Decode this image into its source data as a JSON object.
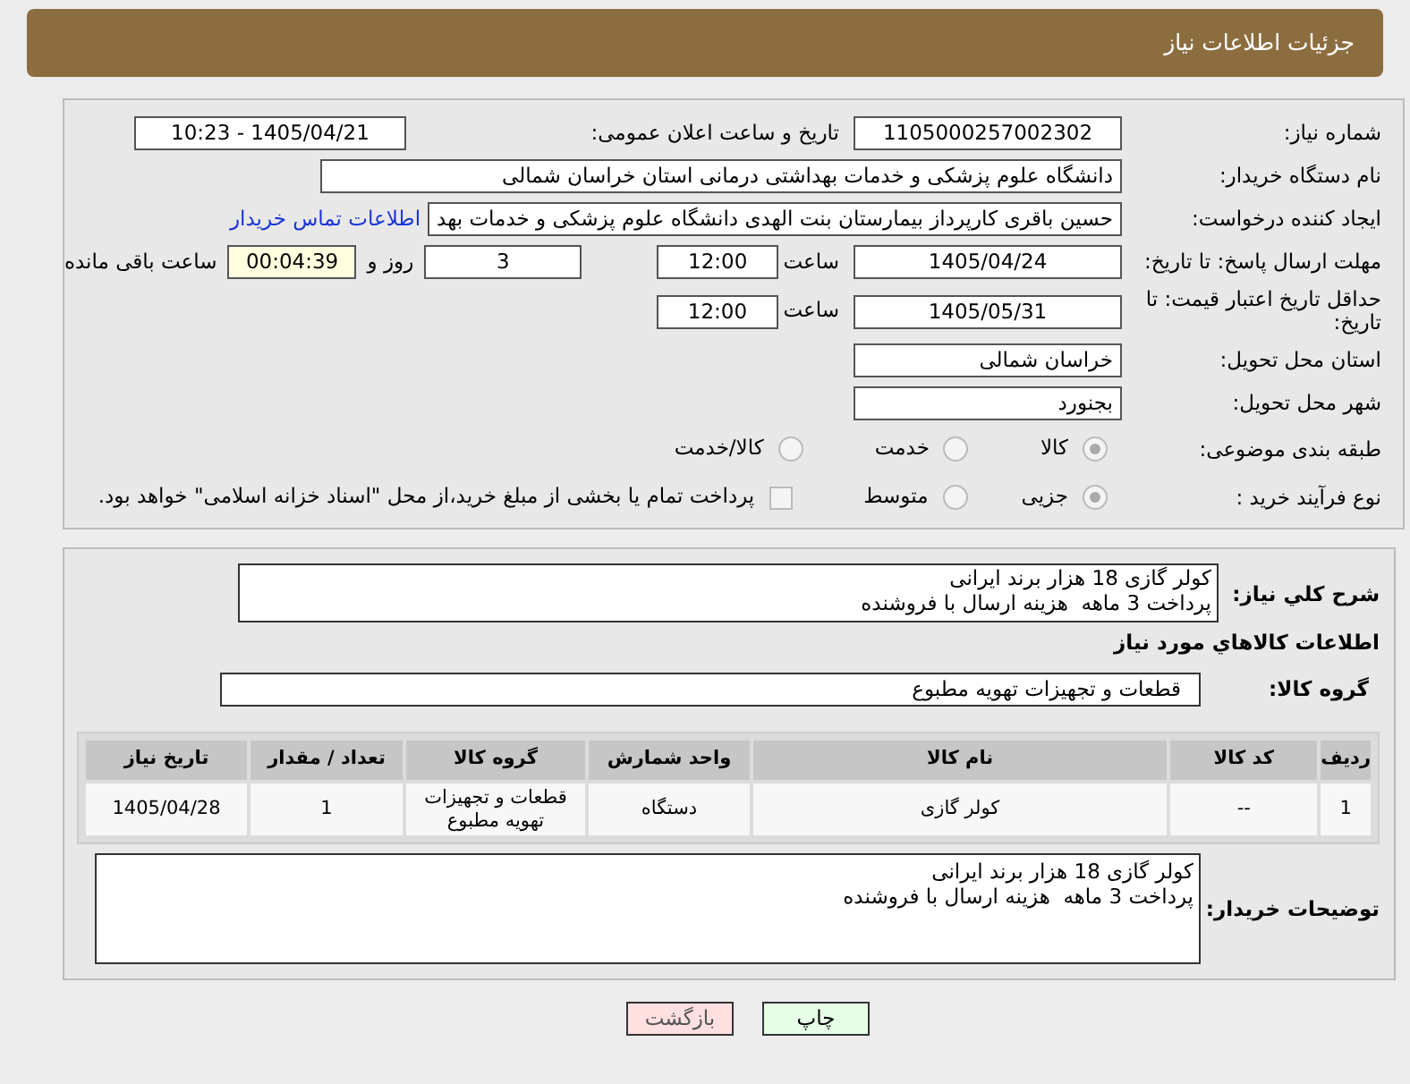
{
  "header": {
    "title": "جزئیات اطلاعات نیاز"
  },
  "need_number": {
    "label": "شماره نیاز:",
    "value": "1105000257002302"
  },
  "announce": {
    "label": "تاریخ و ساعت اعلان عمومی:",
    "value": "1405/04/21 - 10:23"
  },
  "buyer": {
    "label": "نام دستگاه خریدار:",
    "value": "دانشگاه علوم پزشکی و خدمات بهداشتی درمانی استان خراسان شمالی"
  },
  "requester": {
    "label": "ایجاد کننده درخواست:",
    "value": "حسین باقری کارپرداز بیمارستان بنت الهدی دانشگاه علوم پزشکی و خدمات بهد",
    "link": "اطلاعات تماس خریدار"
  },
  "deadline": {
    "label": "مهلت ارسال پاسخ: تا تاریخ:",
    "date": "1405/04/24",
    "time_label": "ساعت",
    "time": "12:00",
    "days": "3",
    "days_label": "روز و",
    "remaining": "00:04:39",
    "remaining_label": "ساعت باقی مانده"
  },
  "validity": {
    "label": "حداقل تاریخ اعتبار قیمت: تا تاریخ:",
    "date": "1405/05/31",
    "time_label": "ساعت",
    "time": "12:00"
  },
  "province": {
    "label": "استان محل تحویل:",
    "value": "خراسان شمالی"
  },
  "city": {
    "label": "شهر محل تحویل:",
    "value": "بجنورد"
  },
  "category": {
    "label": "طبقه بندی موضوعی:",
    "options": [
      {
        "label": "کالا",
        "selected": true
      },
      {
        "label": "خدمت",
        "selected": false
      },
      {
        "label": "کالا/خدمت",
        "selected": false
      }
    ]
  },
  "process": {
    "label": "نوع فرآیند خرید :",
    "options": [
      {
        "label": "جزیی",
        "selected": true
      },
      {
        "label": "متوسط",
        "selected": false
      }
    ],
    "checkbox": {
      "label": "پرداخت تمام یا بخشی از مبلغ خرید،از محل \"اسناد خزانه اسلامی\" خواهد بود.",
      "checked": false
    }
  },
  "description": {
    "label": "شرح كلي نياز:",
    "lines": [
      "کولر گازی 18 هزار برند ایرانی",
      "پرداخت 3 ماهه  هزینه ارسال با فروشنده"
    ]
  },
  "goods": {
    "title": "اطلاعات كالاهاي مورد نياز",
    "group_label": "گروه کالا:",
    "group_value": "قطعات و تجهیزات تهویه مطبوع",
    "columns": [
      "ردیف",
      "کد کالا",
      "نام کالا",
      "واحد شمارش",
      "گروه کالا",
      "تعداد / مقدار",
      "تاریخ نیاز"
    ],
    "rows": [
      [
        "1",
        "--",
        "کولر گازی",
        "دستگاه",
        "قطعات و تجهیزات تهویه مطبوع",
        "1",
        "1405/04/28"
      ]
    ]
  },
  "buyer_notes": {
    "label": "توضیحات خریدار:",
    "lines": [
      "کولر گازی 18 هزار برند ایرانی",
      "پرداخت 3 ماهه  هزینه ارسال با فروشنده"
    ]
  },
  "buttons": [
    {
      "label": "چاپ",
      "kind": "print"
    },
    {
      "label": "بازگشت",
      "kind": "back"
    }
  ]
}
